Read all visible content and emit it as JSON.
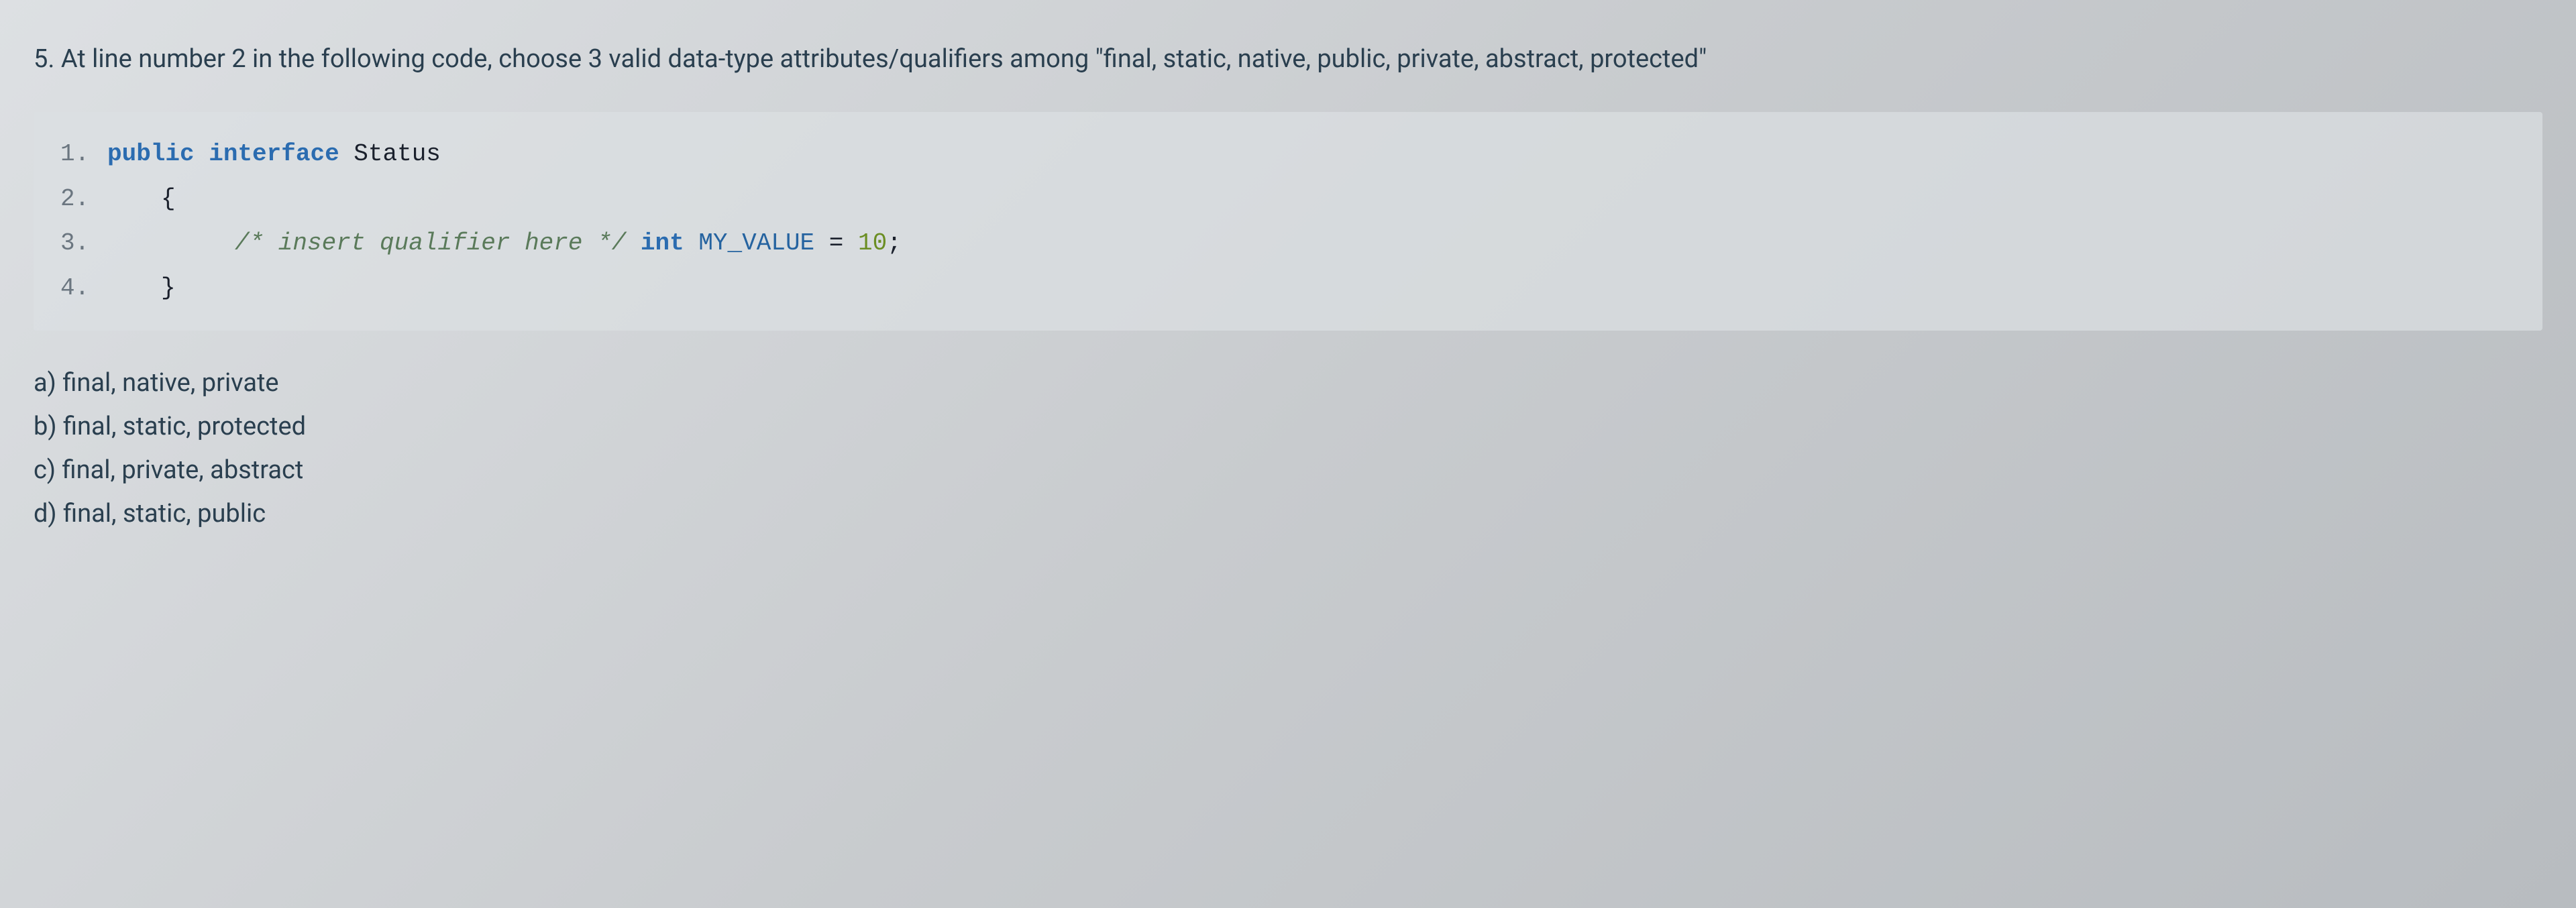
{
  "question": {
    "number": "5.",
    "text": "At line number 2 in the following code, choose 3 valid data-type attributes/qualifiers among \"final, static, native, public, private, abstract, protected\""
  },
  "code": {
    "lines": [
      {
        "num": "1.",
        "access": "public",
        "iface_kw": "interface",
        "class_name": "Status"
      },
      {
        "num": "2.",
        "brace": "{"
      },
      {
        "num": "3.",
        "comment": "/* insert qualifier here */",
        "type_kw": "int",
        "var": "MY_VALUE",
        "eq": "=",
        "value": "10",
        "semi": ";"
      },
      {
        "num": "4.",
        "brace": "}"
      }
    ]
  },
  "options": {
    "a": "a) final, native, private",
    "b": "b) final, static, protected",
    "c": "c) final, private, abstract",
    "d": "d) final, static, public"
  }
}
